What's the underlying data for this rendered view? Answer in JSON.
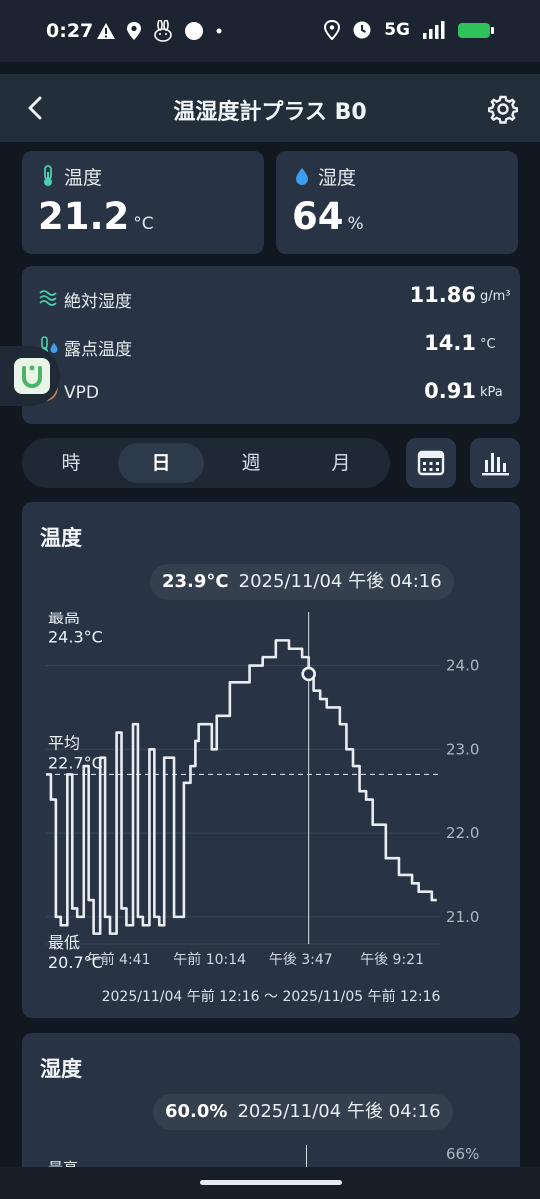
{
  "status_bar": {
    "time": "0:27",
    "network": "5G",
    "left_icons": [
      "warning-icon",
      "location-icon",
      "rabbit-icon",
      "circle-icon",
      "dot-icon"
    ],
    "right_icons": [
      "location-icon",
      "clock-icon",
      "signal-icon",
      "battery-icon"
    ]
  },
  "app_bar": {
    "title": "温湿度計プラス B0",
    "back_icon": "chevron-left-icon",
    "settings_icon": "gear-icon"
  },
  "tiles": {
    "temperature": {
      "label": "温度",
      "value": "21.2",
      "unit": "°C",
      "icon": "thermometer-icon"
    },
    "humidity": {
      "label": "湿度",
      "value": "64",
      "unit": "%",
      "icon": "droplet-icon"
    }
  },
  "metrics": [
    {
      "label": "絶対湿度",
      "value": "11.86",
      "unit": "g/m³",
      "icon": "wave-icon"
    },
    {
      "label": "露点温度",
      "value": "14.1",
      "unit": "°C",
      "icon": "dewpoint-icon"
    },
    {
      "label": "VPD",
      "value": "0.91",
      "unit": "kPa",
      "icon": "leaf-icon"
    }
  ],
  "periods": {
    "items": [
      "時",
      "日",
      "週",
      "月"
    ],
    "selected": "日"
  },
  "actions": {
    "calendar_icon": "calendar-icon",
    "bar_chart_icon": "bar-chart-icon"
  },
  "temp_chart": {
    "title": "温度",
    "tooltip_value": "23.9°C",
    "tooltip_time": "2025/11/04 午後 04:16",
    "max_label": "最高",
    "max_value": "24.3°C",
    "avg_label": "平均",
    "avg_value": "22.7°C",
    "min_label": "最低",
    "min_value": "20.7°C",
    "range": "2025/11/04 午前 12:16 ～ 2025/11/05 午前 12:16"
  },
  "humidity_chart": {
    "title": "湿度",
    "tooltip_value": "60.0%",
    "tooltip_time": "2025/11/04 午後 04:16",
    "max_label": "最高",
    "top_tick": "66%"
  },
  "chart_data": {
    "type": "line",
    "title": "温度",
    "x_unit": "hours since 2025/11/04 午前 12:16",
    "x_range": [
      0,
      24
    ],
    "ylim": [
      20.7,
      24.4
    ],
    "y_ticks": [
      "24.0",
      "23.0",
      "22.0",
      "21.0"
    ],
    "y_tick_values": [
      24,
      23,
      22,
      21
    ],
    "x_tick_labels": [
      "午前 4:41",
      "午前 10:14",
      "午後 3:47",
      "午後 9:21"
    ],
    "x_tick_positions": [
      4.42,
      9.97,
      15.52,
      21.08
    ],
    "average": 22.7,
    "max": 24.3,
    "min": 20.7,
    "cursor": {
      "x": 16.0,
      "y": 23.9
    },
    "grid": true,
    "legend": "none",
    "line_color": "#e9edf2",
    "series": [
      {
        "x": [
          0.0,
          0.3,
          0.6,
          0.9,
          1.3,
          1.6,
          1.9,
          2.3,
          2.6,
          2.9,
          3.3,
          3.6,
          3.9,
          4.3,
          4.6,
          4.9,
          5.3,
          5.6,
          5.9,
          6.3,
          6.6,
          6.9,
          7.2,
          7.5,
          7.8,
          8.1,
          8.4,
          8.8,
          9.1,
          9.3,
          9.7,
          10.1,
          10.4,
          10.8,
          11.2,
          11.6,
          12.0,
          12.4,
          12.8,
          13.2,
          13.6,
          14.0,
          14.4,
          14.8,
          15.2,
          15.6,
          16.0,
          16.3,
          16.7,
          17.1,
          17.5,
          17.9,
          18.3,
          18.7,
          19.1,
          19.5,
          19.9,
          20.3,
          20.7,
          21.1,
          21.5,
          21.9,
          22.3,
          22.7,
          23.1,
          23.5,
          23.8
        ],
        "y": [
          22.7,
          22.4,
          21.0,
          20.9,
          22.7,
          21.1,
          21.0,
          22.8,
          21.2,
          20.8,
          22.9,
          21.0,
          20.8,
          23.2,
          21.1,
          20.9,
          23.3,
          21.0,
          20.9,
          23.0,
          21.0,
          20.9,
          22.9,
          22.9,
          21.0,
          21.0,
          22.6,
          22.8,
          23.1,
          23.3,
          23.3,
          23.0,
          23.4,
          23.4,
          23.8,
          23.8,
          23.8,
          24.0,
          24.0,
          24.1,
          24.1,
          24.3,
          24.3,
          24.2,
          24.2,
          24.1,
          23.9,
          23.7,
          23.6,
          23.5,
          23.5,
          23.3,
          23.0,
          22.8,
          22.5,
          22.4,
          22.1,
          22.1,
          21.7,
          21.7,
          21.5,
          21.5,
          21.4,
          21.3,
          21.3,
          21.2,
          21.2
        ]
      }
    ]
  }
}
